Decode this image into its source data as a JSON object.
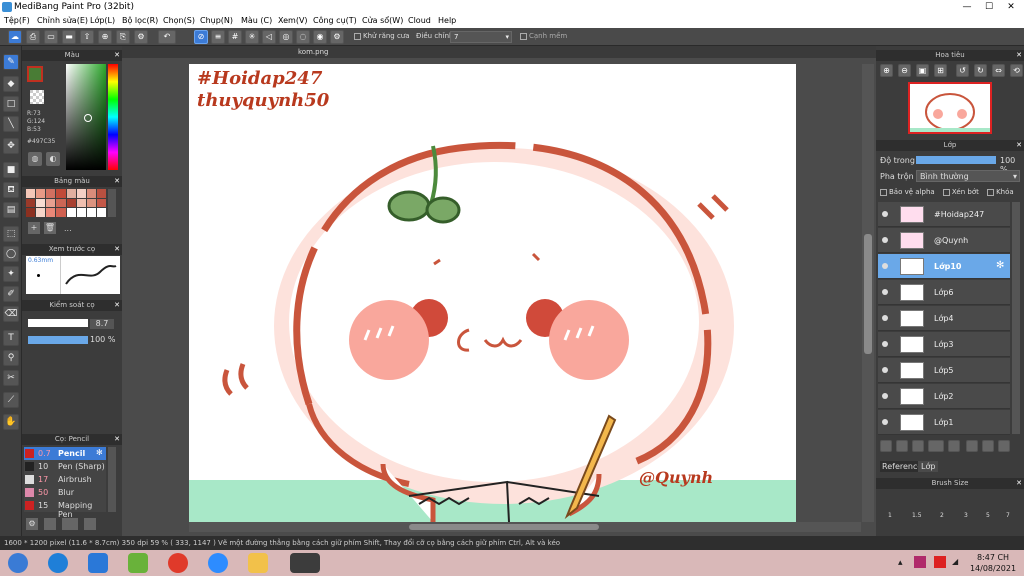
{
  "window": {
    "title": "MediBang Paint Pro (32bit)"
  },
  "menu": [
    "Tệp(F)",
    "Chỉnh sửa(E)",
    "Lớp(L)",
    "Bộ lọc(R)",
    "Chọn(S)",
    "Chụp(N)",
    "Màu (C)",
    "Xem(V)",
    "Công cụ(T)",
    "Cửa sổ(W)",
    "Cloud",
    "Help"
  ],
  "toolbar": {
    "antialias_label": "Khử răng cưa",
    "adjust_label": "Điều chỉnh",
    "adjust_value": "7",
    "sharp_label": "Cạnh mềm"
  },
  "color_panel": {
    "title": "Màu",
    "r": "R:73",
    "g": "G:124",
    "b": "B:53",
    "hex": "#497C35"
  },
  "palette_panel": {
    "title": "Bảng màu",
    "more": "..."
  },
  "preview_panel": {
    "title": "Xem trước cọ",
    "size": "0.63mm"
  },
  "brush_control": {
    "title": "Kiểm soát cọ",
    "size": "8.7",
    "opacity": "100 %"
  },
  "brush_list": {
    "title": "Cọ: Pencil",
    "items": [
      {
        "size": "0.7",
        "name": "Pencil",
        "color": "#c22"
      },
      {
        "size": "10",
        "name": "Pen (Sharp)",
        "color": "#222"
      },
      {
        "size": "17",
        "name": "Airbrush",
        "color": "#ddd"
      },
      {
        "size": "50",
        "name": "Blur",
        "color": "#d8a"
      },
      {
        "size": "15",
        "name": "Mapping Pen",
        "color": "#c22"
      }
    ]
  },
  "tab": {
    "filename": "kom.png"
  },
  "art": {
    "tag1": "#Hoidap247",
    "tag2": "thuyquynh50",
    "sign": "@Quynh"
  },
  "navigator": {
    "title": "Hoa tiêu"
  },
  "layers": {
    "title": "Lớp",
    "opacity_label": "Độ trong",
    "opacity_value": "100 %",
    "blend_label": "Pha trộn",
    "blend_value": "Bình thường",
    "protect_alpha": "Bảo vệ alpha",
    "clip": "Xén bớt",
    "lock": "Khóa",
    "items": [
      "#Hoidap247",
      "@Quynh",
      "Lớp10",
      "Lớp6",
      "Lớp4",
      "Lớp3",
      "Lớp5",
      "Lớp2",
      "Lớp1"
    ],
    "selected": "Lớp10",
    "tab_reference": "Reference",
    "tab_layer": "Lớp"
  },
  "brush_size": {
    "title": "Brush Size",
    "values": [
      "1",
      "1.5",
      "2",
      "3",
      "5",
      "7"
    ]
  },
  "status": {
    "text": "1600 * 1200 pixel  (11.6 * 8.7cm)  350 dpi  59 %  ( 333, 1147 )  Vẽ một đường thẳng bằng cách giữ phím Shift, Thay đổi cỡ cọ bằng cách giữ phím Ctrl, Alt và kéo"
  },
  "taskbar": {
    "time": "8:47 CH",
    "date": "14/08/2021"
  }
}
